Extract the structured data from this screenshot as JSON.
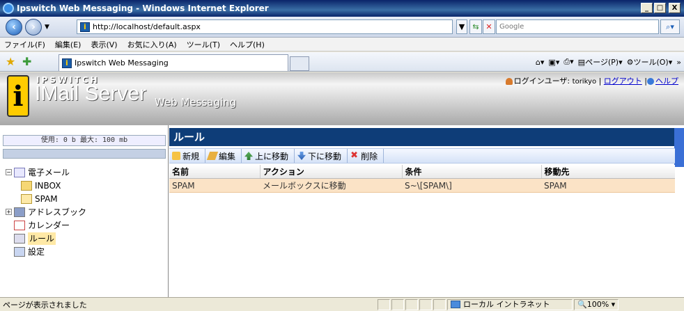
{
  "window": {
    "title": "Ipswitch Web Messaging - Windows Internet Explorer",
    "minimize": "_",
    "maximize": "□",
    "close": "X"
  },
  "address": {
    "url": "http://localhost/default.aspx",
    "search_placeholder": "Google"
  },
  "menu": [
    "ファイル(F)",
    "編集(E)",
    "表示(V)",
    "お気に入り(A)",
    "ツール(T)",
    "ヘルプ(H)"
  ],
  "tab": {
    "label": "Ipswitch Web Messaging"
  },
  "commandbar": {
    "page": "ページ(P)",
    "tools": "ツール(O)",
    "more": "»"
  },
  "banner": {
    "brand_top": "IPSWITCH",
    "brand_main": "IMail Server",
    "brand_sub": "Web Messaging",
    "user_label": "ログインユーザ:",
    "username": "torikyo",
    "logout": "ログアウト",
    "help": "ヘルプ",
    "sep": "|"
  },
  "sidebar": {
    "quota": "使用: 0 b 最大: 100 mb",
    "items": [
      {
        "label": "電子メール",
        "icon": "mail-icon"
      },
      {
        "label": "INBOX",
        "icon": "inbox-folder-icon"
      },
      {
        "label": "SPAM",
        "icon": "folder-icon"
      },
      {
        "label": "アドレスブック",
        "icon": "addressbook-icon"
      },
      {
        "label": "カレンダー",
        "icon": "calendar-icon"
      },
      {
        "label": "ルール",
        "icon": "rules-icon"
      },
      {
        "label": "設定",
        "icon": "settings-icon"
      }
    ]
  },
  "main": {
    "title": "ルール",
    "toolbar": {
      "new": "新規",
      "edit": "編集",
      "move_up": "上に移動",
      "move_down": "下に移動",
      "delete": "削除"
    },
    "table": {
      "headers": [
        "名前",
        "アクション",
        "条件",
        "移動先"
      ],
      "rows": [
        [
          "SPAM",
          "メールボックスに移動",
          "S~\\[SPAM\\]",
          "SPAM"
        ]
      ]
    }
  },
  "status": {
    "text": "ページが表示されました",
    "zone": "ローカル イントラネット",
    "zoom": "100%"
  }
}
